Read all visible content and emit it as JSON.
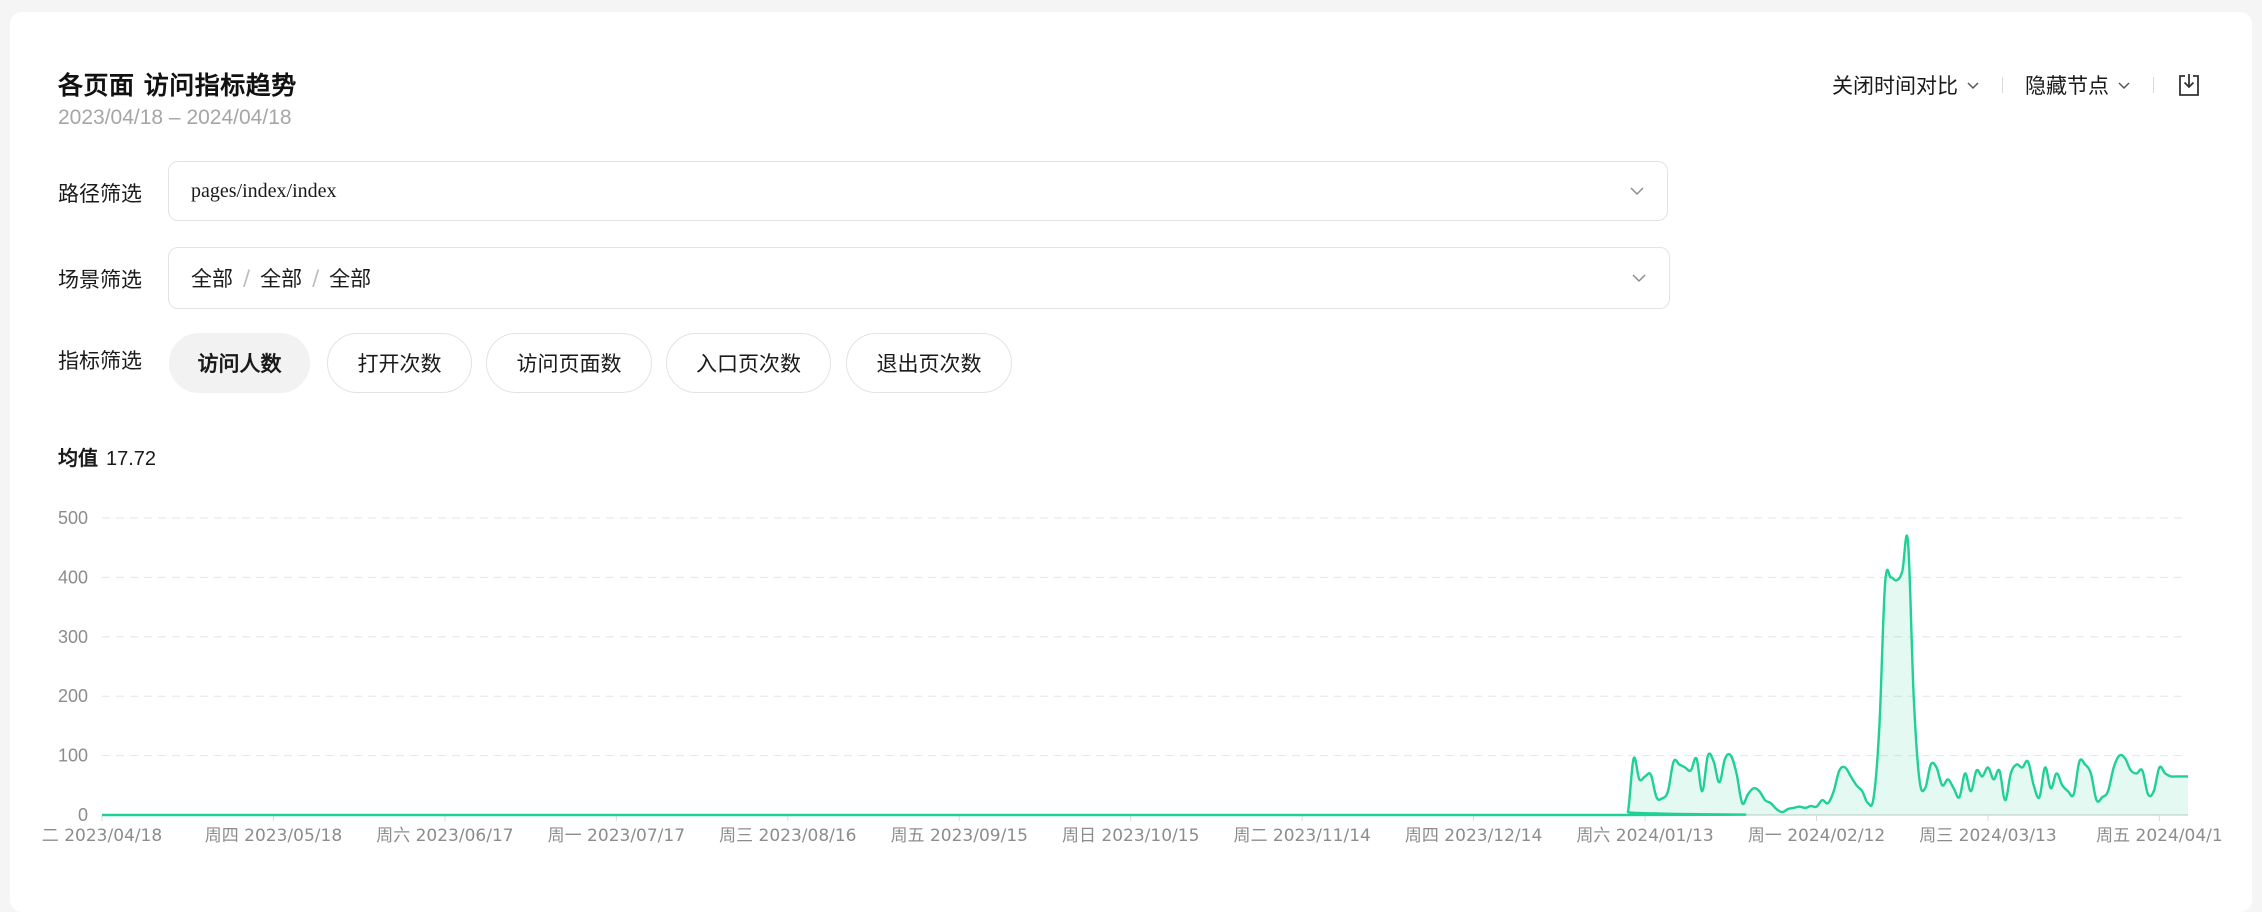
{
  "header": {
    "title": "各页面 访问指标趋势",
    "date_range": "2023/04/18 – 2024/04/18"
  },
  "toolbar": {
    "compare_label": "关闭时间对比",
    "nodes_label": "隐藏节点"
  },
  "filters": {
    "path_label": "路径筛选",
    "path_value": "pages/index/index",
    "scene_label": "场景筛选",
    "scene_values": [
      "全部",
      "全部",
      "全部"
    ],
    "scene_sep": "/",
    "metric_label": "指标筛选",
    "metrics": [
      {
        "label": "访问人数",
        "active": true
      },
      {
        "label": "打开次数",
        "active": false
      },
      {
        "label": "访问页面数",
        "active": false
      },
      {
        "label": "入口页次数",
        "active": false
      },
      {
        "label": "退出页次数",
        "active": false
      }
    ]
  },
  "summary": {
    "avg_label": "均值",
    "avg_value": "17.72"
  },
  "colors": {
    "line": "#1fd193",
    "fill": "rgba(31,209,147,0.12)",
    "grid": "#e6e6e6"
  },
  "chart_data": {
    "type": "area",
    "ylim": [
      0,
      500
    ],
    "y_ticks": [
      "0",
      "100",
      "200",
      "300",
      "400",
      "500"
    ],
    "x_tick_labels": [
      "二 2023/04/18",
      "周四 2023/05/18",
      "周六 2023/06/17",
      "周一 2023/07/17",
      "周三 2023/08/16",
      "周五 2023/09/15",
      "周日 2023/10/15",
      "周二 2023/11/14",
      "周四 2023/12/14",
      "周六 2024/01/13",
      "周一 2024/02/12",
      "周三 2024/03/13",
      "周五 2024/04/1"
    ],
    "x_start": "2023/04/18",
    "x_end": "2024/04/18",
    "grid": true,
    "series": [
      {
        "values_by_day_index": [
          [
            0,
            0
          ],
          [
            266,
            0
          ],
          [
            267,
            5
          ],
          [
            268,
            95
          ],
          [
            269,
            60
          ],
          [
            270,
            65
          ],
          [
            271,
            68
          ],
          [
            272,
            30
          ],
          [
            273,
            28
          ],
          [
            274,
            40
          ],
          [
            275,
            90
          ],
          [
            276,
            85
          ],
          [
            277,
            80
          ],
          [
            278,
            75
          ],
          [
            279,
            95
          ],
          [
            280,
            40
          ],
          [
            281,
            100
          ],
          [
            282,
            90
          ],
          [
            283,
            55
          ],
          [
            284,
            95
          ],
          [
            285,
            100
          ],
          [
            286,
            70
          ],
          [
            287,
            20
          ],
          [
            288,
            35
          ],
          [
            289,
            45
          ],
          [
            290,
            40
          ],
          [
            291,
            25
          ],
          [
            292,
            20
          ],
          [
            293,
            10
          ],
          [
            294,
            5
          ],
          [
            295,
            10
          ],
          [
            296,
            12
          ],
          [
            297,
            14
          ],
          [
            298,
            12
          ],
          [
            299,
            15
          ],
          [
            300,
            14
          ],
          [
            301,
            25
          ],
          [
            302,
            20
          ],
          [
            303,
            40
          ],
          [
            304,
            75
          ],
          [
            305,
            80
          ],
          [
            306,
            65
          ],
          [
            307,
            50
          ],
          [
            308,
            40
          ],
          [
            309,
            20
          ],
          [
            310,
            30
          ],
          [
            311,
            150
          ],
          [
            312,
            390
          ],
          [
            313,
            400
          ],
          [
            314,
            395
          ],
          [
            315,
            410
          ],
          [
            316,
            460
          ],
          [
            317,
            200
          ],
          [
            318,
            60
          ],
          [
            319,
            45
          ],
          [
            320,
            85
          ],
          [
            321,
            80
          ],
          [
            322,
            50
          ],
          [
            323,
            60
          ],
          [
            324,
            45
          ],
          [
            325,
            30
          ],
          [
            326,
            70
          ],
          [
            327,
            40
          ],
          [
            328,
            75
          ],
          [
            329,
            65
          ],
          [
            330,
            80
          ],
          [
            331,
            60
          ],
          [
            332,
            75
          ],
          [
            333,
            25
          ],
          [
            334,
            70
          ],
          [
            335,
            85
          ],
          [
            336,
            80
          ],
          [
            337,
            90
          ],
          [
            338,
            50
          ],
          [
            339,
            30
          ],
          [
            340,
            80
          ],
          [
            341,
            45
          ],
          [
            342,
            70
          ],
          [
            343,
            50
          ],
          [
            344,
            40
          ],
          [
            345,
            35
          ],
          [
            346,
            90
          ],
          [
            347,
            85
          ],
          [
            348,
            70
          ],
          [
            349,
            25
          ],
          [
            350,
            30
          ],
          [
            351,
            40
          ],
          [
            352,
            80
          ],
          [
            353,
            100
          ],
          [
            354,
            95
          ],
          [
            355,
            75
          ],
          [
            356,
            70
          ],
          [
            357,
            75
          ],
          [
            358,
            35
          ],
          [
            359,
            40
          ],
          [
            360,
            80
          ],
          [
            361,
            70
          ],
          [
            362,
            65
          ],
          [
            363,
            65
          ],
          [
            365,
            65
          ]
        ]
      }
    ]
  }
}
